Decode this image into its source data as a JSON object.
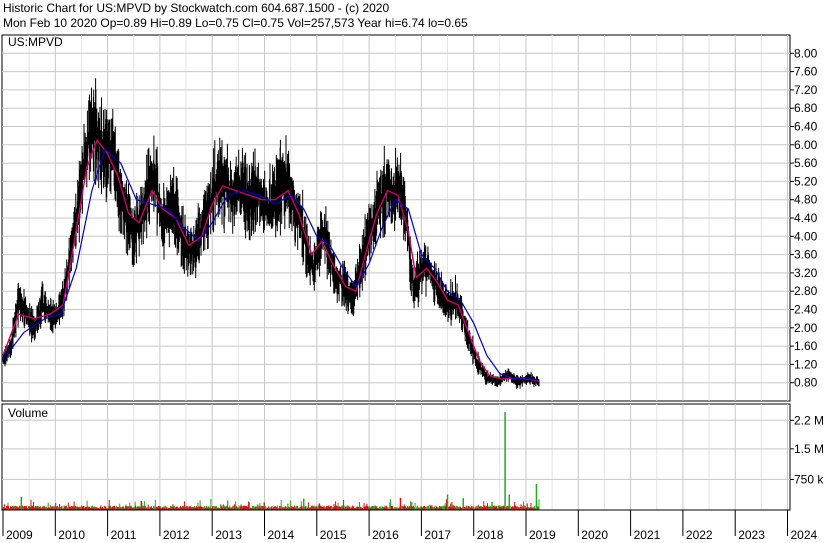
{
  "header": {
    "line1": "Historic Chart for US:MPVD by Stockwatch.com 604.687.1500 - (c) 2020",
    "line2": "Mon Feb 10 2020   Op=0.89   Hi=0.89   Lo=0.75   Cl=0.75   Vol=257,573   Year hi=6.74   lo=0.65"
  },
  "chart_data": {
    "type": "line",
    "symbol_label": "US:MPVD",
    "volume_label": "Volume",
    "colors": {
      "price": "#000000",
      "ma_short": "#cc0066",
      "ma_long": "#0000cc",
      "vol_up": "#22aa22",
      "vol_down": "#dd1111",
      "grid": "#c8c8c8"
    },
    "x_ticks": [
      "2009",
      "2010",
      "2011",
      "2012",
      "2013",
      "2014",
      "2015",
      "2016",
      "2017",
      "2018",
      "2019",
      "2020",
      "2021",
      "2022",
      "2023",
      "2024"
    ],
    "price_axis": {
      "ylim": [
        0.4,
        8.4
      ],
      "ticks": [
        "8.00",
        "7.60",
        "7.20",
        "6.80",
        "6.40",
        "6.00",
        "5.60",
        "5.20",
        "4.80",
        "4.40",
        "4.00",
        "3.60",
        "3.20",
        "2.80",
        "2.40",
        "2.00",
        "1.60",
        "1.20",
        "0.80"
      ]
    },
    "volume_axis": {
      "ylim": [
        0,
        2600000
      ],
      "ticks": [
        {
          "label": "2.2 M",
          "value": 2200000
        },
        {
          "label": "1.5 M",
          "value": 1500000
        },
        {
          "label": "750 k",
          "value": 750000
        }
      ]
    },
    "price_series": [
      {
        "x": 2009.0,
        "y": 1.3
      },
      {
        "x": 2009.15,
        "y": 1.6
      },
      {
        "x": 2009.3,
        "y": 2.6
      },
      {
        "x": 2009.45,
        "y": 2.3
      },
      {
        "x": 2009.6,
        "y": 2.0
      },
      {
        "x": 2009.75,
        "y": 2.5
      },
      {
        "x": 2009.9,
        "y": 2.3
      },
      {
        "x": 2010.0,
        "y": 2.2
      },
      {
        "x": 2010.15,
        "y": 2.6
      },
      {
        "x": 2010.3,
        "y": 3.6
      },
      {
        "x": 2010.45,
        "y": 4.8
      },
      {
        "x": 2010.6,
        "y": 6.0
      },
      {
        "x": 2010.72,
        "y": 6.4
      },
      {
        "x": 2010.85,
        "y": 6.0
      },
      {
        "x": 2011.0,
        "y": 5.7
      },
      {
        "x": 2011.1,
        "y": 5.9
      },
      {
        "x": 2011.2,
        "y": 5.2
      },
      {
        "x": 2011.35,
        "y": 4.5
      },
      {
        "x": 2011.5,
        "y": 4.0
      },
      {
        "x": 2011.6,
        "y": 4.3
      },
      {
        "x": 2011.75,
        "y": 4.9
      },
      {
        "x": 2011.9,
        "y": 5.4
      },
      {
        "x": 2012.0,
        "y": 4.5
      },
      {
        "x": 2012.1,
        "y": 4.3
      },
      {
        "x": 2012.25,
        "y": 4.7
      },
      {
        "x": 2012.4,
        "y": 4.2
      },
      {
        "x": 2012.5,
        "y": 3.7
      },
      {
        "x": 2012.65,
        "y": 3.7
      },
      {
        "x": 2012.8,
        "y": 4.1
      },
      {
        "x": 2012.9,
        "y": 4.5
      },
      {
        "x": 2013.0,
        "y": 4.9
      },
      {
        "x": 2013.1,
        "y": 5.2
      },
      {
        "x": 2013.25,
        "y": 5.2
      },
      {
        "x": 2013.4,
        "y": 4.9
      },
      {
        "x": 2013.55,
        "y": 5.1
      },
      {
        "x": 2013.7,
        "y": 4.8
      },
      {
        "x": 2013.85,
        "y": 5.0
      },
      {
        "x": 2014.0,
        "y": 4.7
      },
      {
        "x": 2014.1,
        "y": 4.6
      },
      {
        "x": 2014.25,
        "y": 5.0
      },
      {
        "x": 2014.4,
        "y": 5.2
      },
      {
        "x": 2014.55,
        "y": 4.7
      },
      {
        "x": 2014.7,
        "y": 4.3
      },
      {
        "x": 2014.85,
        "y": 3.5
      },
      {
        "x": 2014.95,
        "y": 3.3
      },
      {
        "x": 2015.05,
        "y": 3.9
      },
      {
        "x": 2015.15,
        "y": 4.1
      },
      {
        "x": 2015.25,
        "y": 3.6
      },
      {
        "x": 2015.35,
        "y": 3.1
      },
      {
        "x": 2015.5,
        "y": 3.0
      },
      {
        "x": 2015.6,
        "y": 2.7
      },
      {
        "x": 2015.7,
        "y": 2.7
      },
      {
        "x": 2015.8,
        "y": 3.1
      },
      {
        "x": 2015.9,
        "y": 3.6
      },
      {
        "x": 2016.0,
        "y": 4.1
      },
      {
        "x": 2016.1,
        "y": 4.4
      },
      {
        "x": 2016.25,
        "y": 4.9
      },
      {
        "x": 2016.35,
        "y": 5.2
      },
      {
        "x": 2016.45,
        "y": 4.8
      },
      {
        "x": 2016.55,
        "y": 5.1
      },
      {
        "x": 2016.65,
        "y": 4.7
      },
      {
        "x": 2016.75,
        "y": 4.0
      },
      {
        "x": 2016.8,
        "y": 3.3
      },
      {
        "x": 2016.85,
        "y": 2.9
      },
      {
        "x": 2016.95,
        "y": 3.1
      },
      {
        "x": 2017.05,
        "y": 3.5
      },
      {
        "x": 2017.15,
        "y": 3.3
      },
      {
        "x": 2017.25,
        "y": 3.0
      },
      {
        "x": 2017.35,
        "y": 2.8
      },
      {
        "x": 2017.45,
        "y": 2.6
      },
      {
        "x": 2017.55,
        "y": 2.5
      },
      {
        "x": 2017.65,
        "y": 2.6
      },
      {
        "x": 2017.75,
        "y": 2.4
      },
      {
        "x": 2017.85,
        "y": 2.0
      },
      {
        "x": 2017.95,
        "y": 1.6
      },
      {
        "x": 2018.05,
        "y": 1.3
      },
      {
        "x": 2018.15,
        "y": 1.1
      },
      {
        "x": 2018.25,
        "y": 0.9
      },
      {
        "x": 2018.35,
        "y": 0.9
      },
      {
        "x": 2018.45,
        "y": 0.8
      },
      {
        "x": 2018.55,
        "y": 0.9
      },
      {
        "x": 2018.65,
        "y": 1.0
      },
      {
        "x": 2018.75,
        "y": 0.9
      },
      {
        "x": 2018.85,
        "y": 0.8
      },
      {
        "x": 2018.95,
        "y": 0.85
      },
      {
        "x": 2019.05,
        "y": 0.9
      },
      {
        "x": 2019.15,
        "y": 0.85
      },
      {
        "x": 2019.25,
        "y": 0.8
      }
    ],
    "ma_short_series": [
      {
        "x": 2009.0,
        "y": 1.4
      },
      {
        "x": 2009.3,
        "y": 2.3
      },
      {
        "x": 2009.6,
        "y": 2.2
      },
      {
        "x": 2009.9,
        "y": 2.3
      },
      {
        "x": 2010.15,
        "y": 2.5
      },
      {
        "x": 2010.35,
        "y": 3.8
      },
      {
        "x": 2010.6,
        "y": 5.5
      },
      {
        "x": 2010.8,
        "y": 6.1
      },
      {
        "x": 2011.0,
        "y": 5.8
      },
      {
        "x": 2011.2,
        "y": 5.3
      },
      {
        "x": 2011.4,
        "y": 4.5
      },
      {
        "x": 2011.6,
        "y": 4.3
      },
      {
        "x": 2011.85,
        "y": 5.0
      },
      {
        "x": 2012.05,
        "y": 4.6
      },
      {
        "x": 2012.3,
        "y": 4.4
      },
      {
        "x": 2012.55,
        "y": 3.8
      },
      {
        "x": 2012.8,
        "y": 4.0
      },
      {
        "x": 2013.0,
        "y": 4.7
      },
      {
        "x": 2013.2,
        "y": 5.1
      },
      {
        "x": 2013.45,
        "y": 5.0
      },
      {
        "x": 2013.7,
        "y": 4.9
      },
      {
        "x": 2013.95,
        "y": 4.8
      },
      {
        "x": 2014.2,
        "y": 4.8
      },
      {
        "x": 2014.45,
        "y": 5.0
      },
      {
        "x": 2014.65,
        "y": 4.5
      },
      {
        "x": 2014.9,
        "y": 3.6
      },
      {
        "x": 2015.1,
        "y": 3.9
      },
      {
        "x": 2015.3,
        "y": 3.4
      },
      {
        "x": 2015.55,
        "y": 2.9
      },
      {
        "x": 2015.75,
        "y": 2.8
      },
      {
        "x": 2015.95,
        "y": 3.7
      },
      {
        "x": 2016.15,
        "y": 4.5
      },
      {
        "x": 2016.35,
        "y": 5.0
      },
      {
        "x": 2016.55,
        "y": 4.9
      },
      {
        "x": 2016.75,
        "y": 4.1
      },
      {
        "x": 2016.9,
        "y": 3.1
      },
      {
        "x": 2017.1,
        "y": 3.3
      },
      {
        "x": 2017.3,
        "y": 3.0
      },
      {
        "x": 2017.5,
        "y": 2.6
      },
      {
        "x": 2017.7,
        "y": 2.5
      },
      {
        "x": 2017.9,
        "y": 1.9
      },
      {
        "x": 2018.1,
        "y": 1.3
      },
      {
        "x": 2018.3,
        "y": 0.95
      },
      {
        "x": 2018.55,
        "y": 0.88
      },
      {
        "x": 2018.8,
        "y": 0.9
      },
      {
        "x": 2019.05,
        "y": 0.88
      },
      {
        "x": 2019.25,
        "y": 0.83
      }
    ],
    "ma_long_series": [
      {
        "x": 2009.0,
        "y": 1.3
      },
      {
        "x": 2009.4,
        "y": 1.9
      },
      {
        "x": 2009.8,
        "y": 2.2
      },
      {
        "x": 2010.1,
        "y": 2.3
      },
      {
        "x": 2010.4,
        "y": 3.3
      },
      {
        "x": 2010.7,
        "y": 5.0
      },
      {
        "x": 2010.95,
        "y": 5.9
      },
      {
        "x": 2011.25,
        "y": 5.6
      },
      {
        "x": 2011.55,
        "y": 4.8
      },
      {
        "x": 2011.85,
        "y": 4.7
      },
      {
        "x": 2012.15,
        "y": 4.6
      },
      {
        "x": 2012.45,
        "y": 4.2
      },
      {
        "x": 2012.75,
        "y": 3.9
      },
      {
        "x": 2013.0,
        "y": 4.3
      },
      {
        "x": 2013.3,
        "y": 4.9
      },
      {
        "x": 2013.6,
        "y": 5.0
      },
      {
        "x": 2013.9,
        "y": 4.9
      },
      {
        "x": 2014.2,
        "y": 4.7
      },
      {
        "x": 2014.5,
        "y": 4.9
      },
      {
        "x": 2014.75,
        "y": 4.6
      },
      {
        "x": 2015.0,
        "y": 4.0
      },
      {
        "x": 2015.25,
        "y": 3.8
      },
      {
        "x": 2015.5,
        "y": 3.3
      },
      {
        "x": 2015.75,
        "y": 2.9
      },
      {
        "x": 2016.0,
        "y": 3.4
      },
      {
        "x": 2016.25,
        "y": 4.2
      },
      {
        "x": 2016.5,
        "y": 4.8
      },
      {
        "x": 2016.75,
        "y": 4.6
      },
      {
        "x": 2017.0,
        "y": 3.6
      },
      {
        "x": 2017.25,
        "y": 3.3
      },
      {
        "x": 2017.5,
        "y": 2.8
      },
      {
        "x": 2017.75,
        "y": 2.6
      },
      {
        "x": 2018.0,
        "y": 2.1
      },
      {
        "x": 2018.25,
        "y": 1.4
      },
      {
        "x": 2018.5,
        "y": 1.0
      },
      {
        "x": 2018.75,
        "y": 0.9
      },
      {
        "x": 2019.0,
        "y": 0.9
      },
      {
        "x": 2019.25,
        "y": 0.85
      }
    ],
    "volume_spikes": [
      {
        "x": 2009.35,
        "v": 320000,
        "up": true
      },
      {
        "x": 2014.75,
        "v": 280000,
        "up": true
      },
      {
        "x": 2015.05,
        "v": 160000,
        "up": false
      },
      {
        "x": 2016.4,
        "v": 190000,
        "up": true
      },
      {
        "x": 2016.6,
        "v": 300000,
        "up": false
      },
      {
        "x": 2017.5,
        "v": 380000,
        "up": true
      },
      {
        "x": 2017.8,
        "v": 290000,
        "up": true
      },
      {
        "x": 2018.35,
        "v": 200000,
        "up": true
      },
      {
        "x": 2018.6,
        "v": 2400000,
        "up": true
      },
      {
        "x": 2018.68,
        "v": 380000,
        "up": true
      },
      {
        "x": 2019.2,
        "v": 640000,
        "up": true
      }
    ]
  }
}
